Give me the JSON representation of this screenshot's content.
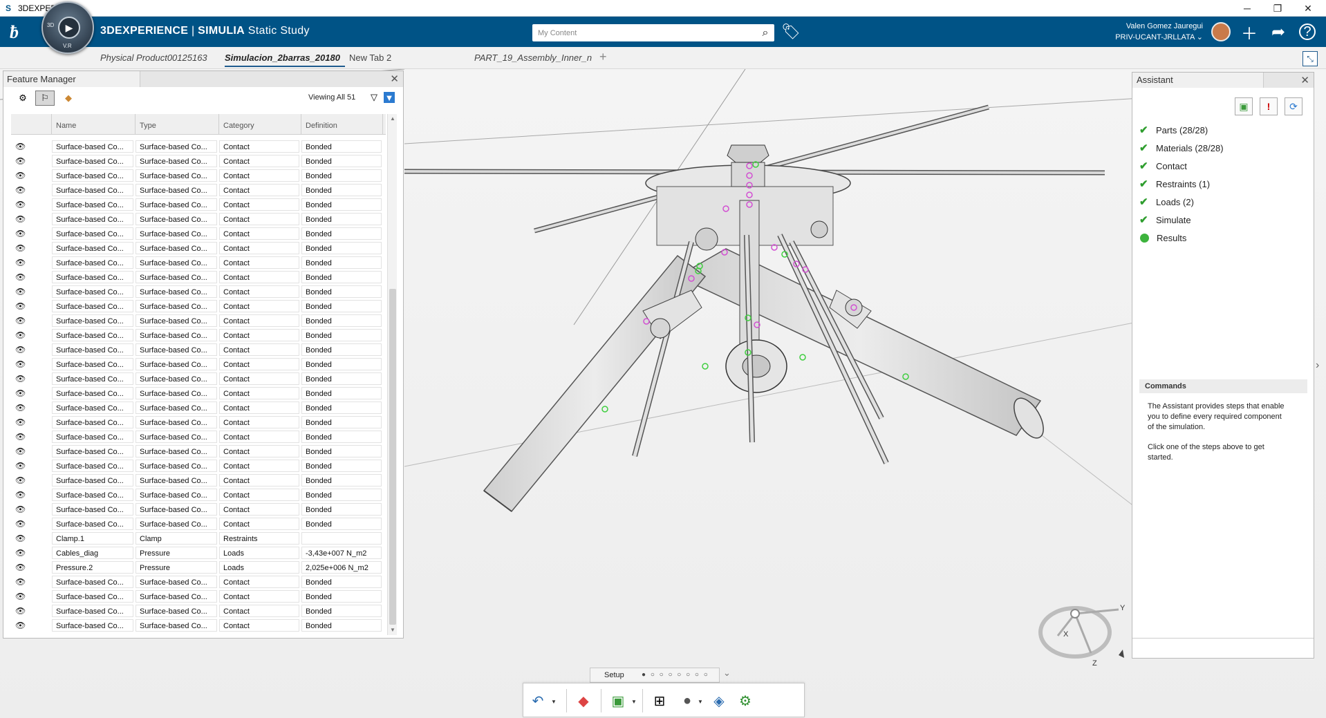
{
  "window": {
    "title": "3DEXPERIENCE"
  },
  "topbar": {
    "brand": "3DEXPERIENCE",
    "separator": " | ",
    "product": "SIMULIA",
    "app": " Static Study",
    "compass_label": "V.R",
    "compass_3d": "3D",
    "search_placeholder": "My Content",
    "user_name": "Valen Gomez Jauregui",
    "user_tenant": "PRIV-UCANT-JRLLATA"
  },
  "tabs": [
    {
      "label": "Physical Product00125163"
    },
    {
      "label": "Simulacion_2barras_20180"
    },
    {
      "label": "New Tab 2"
    },
    {
      "label": "PART_19_Assembly_Inner_n"
    }
  ],
  "feature_manager": {
    "title": "Feature Manager",
    "viewing": "Viewing All 51",
    "columns": [
      "Name",
      "Type",
      "Category",
      "Definition"
    ],
    "rows": [
      [
        "Surface-based Co...",
        "Surface-based Co...",
        "Contact",
        "Bonded"
      ],
      [
        "Surface-based Co...",
        "Surface-based Co...",
        "Contact",
        "Bonded"
      ],
      [
        "Surface-based Co...",
        "Surface-based Co...",
        "Contact",
        "Bonded"
      ],
      [
        "Surface-based Co...",
        "Surface-based Co...",
        "Contact",
        "Bonded"
      ],
      [
        "Surface-based Co...",
        "Surface-based Co...",
        "Contact",
        "Bonded"
      ],
      [
        "Surface-based Co...",
        "Surface-based Co...",
        "Contact",
        "Bonded"
      ],
      [
        "Surface-based Co...",
        "Surface-based Co...",
        "Contact",
        "Bonded"
      ],
      [
        "Surface-based Co...",
        "Surface-based Co...",
        "Contact",
        "Bonded"
      ],
      [
        "Surface-based Co...",
        "Surface-based Co...",
        "Contact",
        "Bonded"
      ],
      [
        "Surface-based Co...",
        "Surface-based Co...",
        "Contact",
        "Bonded"
      ],
      [
        "Surface-based Co...",
        "Surface-based Co...",
        "Contact",
        "Bonded"
      ],
      [
        "Surface-based Co...",
        "Surface-based Co...",
        "Contact",
        "Bonded"
      ],
      [
        "Surface-based Co...",
        "Surface-based Co...",
        "Contact",
        "Bonded"
      ],
      [
        "Surface-based Co...",
        "Surface-based Co...",
        "Contact",
        "Bonded"
      ],
      [
        "Surface-based Co...",
        "Surface-based Co...",
        "Contact",
        "Bonded"
      ],
      [
        "Surface-based Co...",
        "Surface-based Co...",
        "Contact",
        "Bonded"
      ],
      [
        "Surface-based Co...",
        "Surface-based Co...",
        "Contact",
        "Bonded"
      ],
      [
        "Surface-based Co...",
        "Surface-based Co...",
        "Contact",
        "Bonded"
      ],
      [
        "Surface-based Co...",
        "Surface-based Co...",
        "Contact",
        "Bonded"
      ],
      [
        "Surface-based Co...",
        "Surface-based Co...",
        "Contact",
        "Bonded"
      ],
      [
        "Surface-based Co...",
        "Surface-based Co...",
        "Contact",
        "Bonded"
      ],
      [
        "Surface-based Co...",
        "Surface-based Co...",
        "Contact",
        "Bonded"
      ],
      [
        "Surface-based Co...",
        "Surface-based Co...",
        "Contact",
        "Bonded"
      ],
      [
        "Surface-based Co...",
        "Surface-based Co...",
        "Contact",
        "Bonded"
      ],
      [
        "Surface-based Co...",
        "Surface-based Co...",
        "Contact",
        "Bonded"
      ],
      [
        "Surface-based Co...",
        "Surface-based Co...",
        "Contact",
        "Bonded"
      ],
      [
        "Surface-based Co...",
        "Surface-based Co...",
        "Contact",
        "Bonded"
      ],
      [
        "Clamp.1",
        "Clamp",
        "Restraints",
        ""
      ],
      [
        "Cables_diag",
        "Pressure",
        "Loads",
        "-3,43e+007 N_m2"
      ],
      [
        "Pressure.2",
        "Pressure",
        "Loads",
        "2,025e+006 N_m2"
      ],
      [
        "Surface-based Co...",
        "Surface-based Co...",
        "Contact",
        "Bonded"
      ],
      [
        "Surface-based Co...",
        "Surface-based Co...",
        "Contact",
        "Bonded"
      ],
      [
        "Surface-based Co...",
        "Surface-based Co...",
        "Contact",
        "Bonded"
      ],
      [
        "Surface-based Co...",
        "Surface-based Co...",
        "Contact",
        "Bonded"
      ]
    ]
  },
  "assistant": {
    "title": "Assistant",
    "steps": [
      {
        "label": "Parts (28/28)",
        "state": "done"
      },
      {
        "label": "Materials (28/28)",
        "state": "done"
      },
      {
        "label": "Contact",
        "state": "done"
      },
      {
        "label": "Restraints (1)",
        "state": "done"
      },
      {
        "label": "Loads (2)",
        "state": "done"
      },
      {
        "label": "Simulate",
        "state": "done"
      },
      {
        "label": "Results",
        "state": "current"
      }
    ],
    "commands_title": "Commands",
    "commands_text1": "The Assistant provides steps that enable you to define every required component of the simulation.",
    "commands_text2": "Click one of the steps above to get started."
  },
  "bottom": {
    "setup_label": "Setup",
    "setup_dots": "● ○ ○ ○ ○ ○ ○ ○"
  },
  "axes": {
    "x": "X",
    "y": "Y",
    "z": "Z"
  },
  "colors": {
    "brand_blue": "#005386",
    "check_green": "#2f9e2f"
  }
}
